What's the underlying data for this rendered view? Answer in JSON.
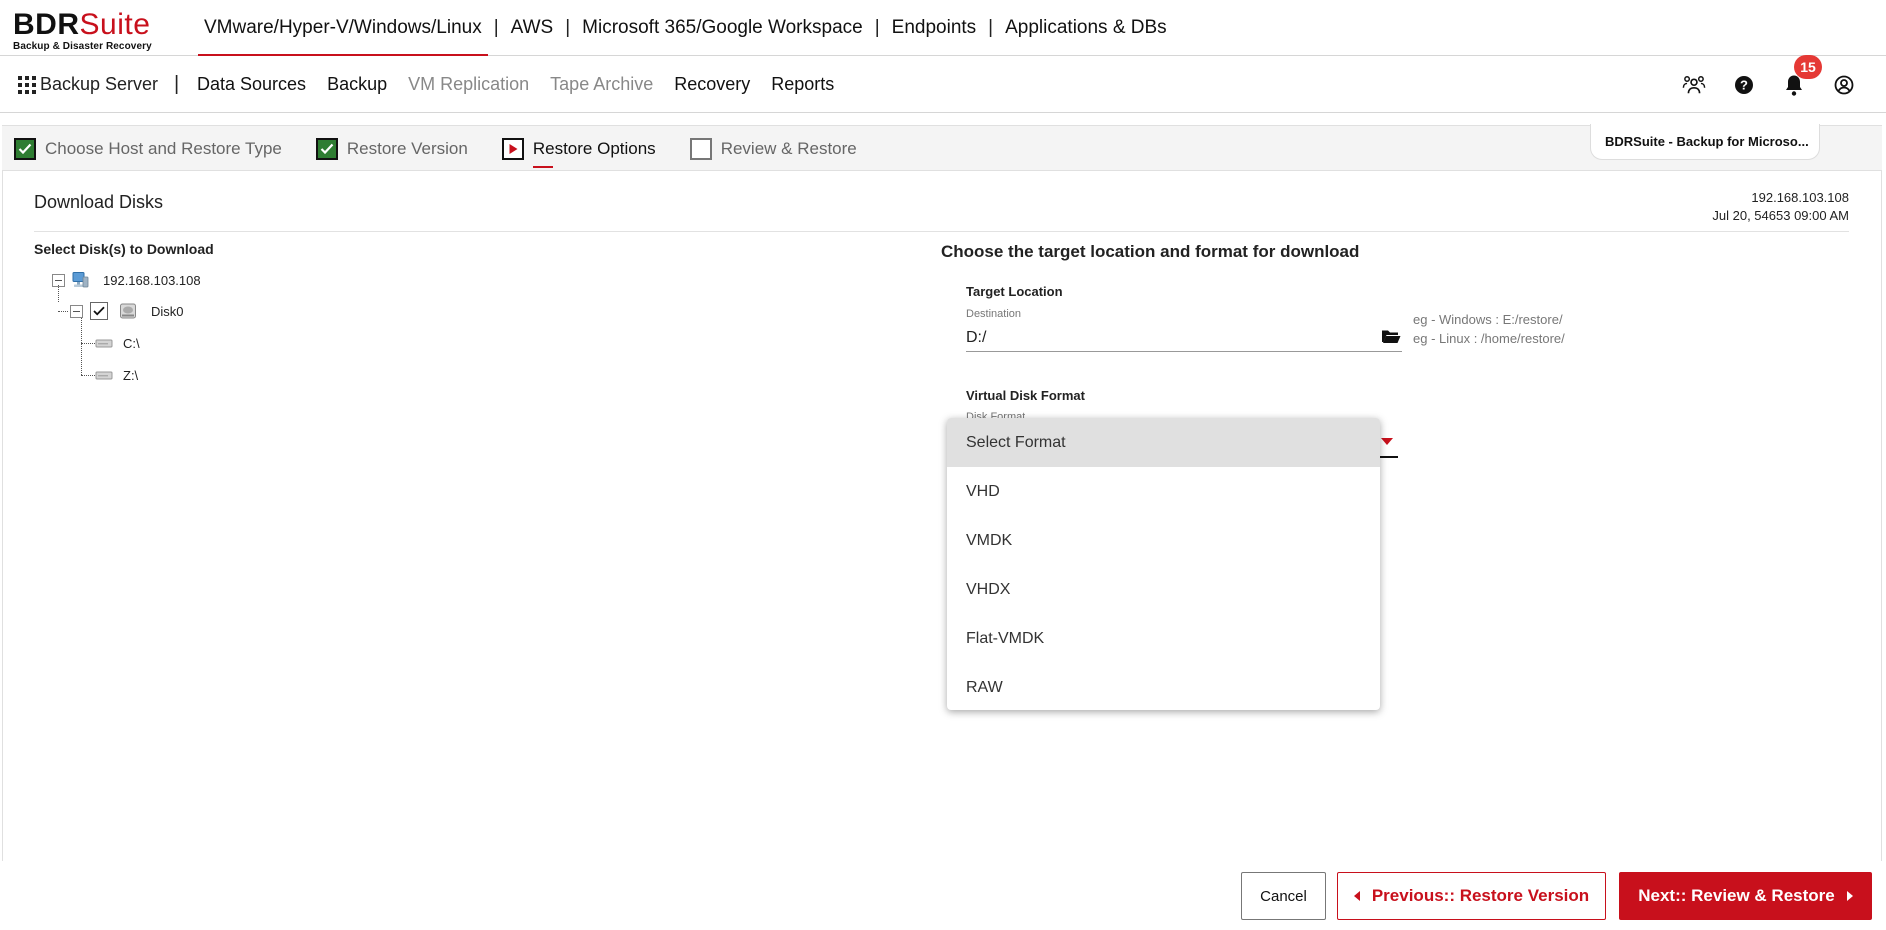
{
  "brand": {
    "name_bold": "BDR",
    "name_light": "Suite",
    "tagline": "Backup & Disaster Recovery",
    "accent_color": "#c8101c"
  },
  "product_nav": {
    "items": [
      {
        "label": "VMware/Hyper-V/Windows/Linux",
        "active": true
      },
      {
        "label": "AWS"
      },
      {
        "label": "Microsoft 365/Google Workspace"
      },
      {
        "label": "Endpoints"
      },
      {
        "label": "Applications & DBs"
      }
    ],
    "separator": "|"
  },
  "nav": {
    "server_label": "Backup Server",
    "separator": "|",
    "items": [
      {
        "label": "Data Sources"
      },
      {
        "label": "Backup"
      },
      {
        "label": "VM Replication",
        "disabled": true
      },
      {
        "label": "Tape Archive",
        "disabled": true
      },
      {
        "label": "Recovery"
      },
      {
        "label": "Reports"
      }
    ],
    "notification_count": "15",
    "icons": [
      "users-icon",
      "help-icon",
      "bell-icon",
      "account-icon"
    ]
  },
  "wizard": {
    "steps": [
      {
        "label": "Choose Host and Restore Type",
        "state": "done"
      },
      {
        "label": "Restore Version",
        "state": "done"
      },
      {
        "label": "Restore Options",
        "state": "current"
      },
      {
        "label": "Review & Restore",
        "state": "todo"
      }
    ],
    "module_tab": "BDRSuite - Backup for Microso..."
  },
  "page": {
    "title": "Download Disks",
    "host_ip": "192.168.103.108",
    "host_datetime": "Jul 20, 54653 09:00 AM"
  },
  "disk_tree": {
    "title": "Select Disk(s) to Download",
    "host": "192.168.103.108",
    "disk": "Disk0",
    "partitions": [
      "C:\\",
      "Z:\\"
    ]
  },
  "target": {
    "title": "Choose the target location and format for download",
    "location_label": "Target Location",
    "destination_label": "Destination",
    "destination_value": "D:/",
    "hint_windows": "eg - Windows : E:/restore/",
    "hint_linux": "eg - Linux : /home/restore/",
    "format_label": "Virtual Disk Format",
    "format_float_label": "Disk Format",
    "format_options": [
      "Select Format",
      "VHD",
      "VMDK",
      "VHDX",
      "Flat-VMDK",
      "RAW"
    ],
    "selected_index": 0
  },
  "footer": {
    "cancel_label": "Cancel",
    "prev_label": "Previous:: Restore Version",
    "next_label": "Next:: Review & Restore"
  }
}
